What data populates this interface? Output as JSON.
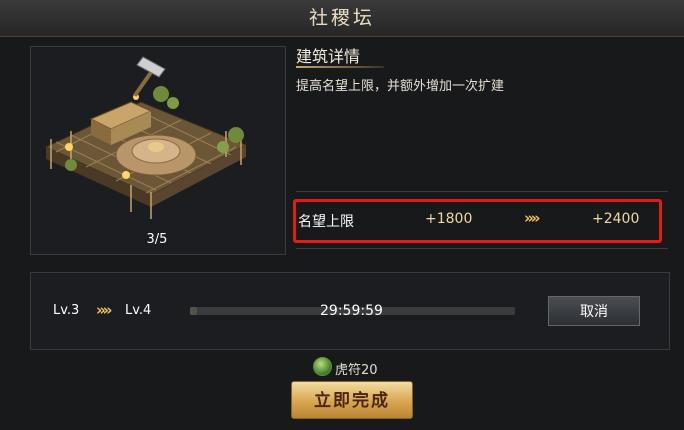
{
  "header": {
    "title": "社稷坛"
  },
  "building": {
    "icon": "hammer-icon",
    "progress_label": "3/5"
  },
  "details": {
    "section_title": "建筑详情",
    "description": "提高名望上限，并额外增加一次扩建",
    "stat": {
      "label": "名望上限",
      "current": "+1800",
      "arrow": "»»",
      "next": "+2400"
    }
  },
  "upgrade": {
    "from_level": "Lv.3",
    "arrow": "»»",
    "to_level": "Lv.4",
    "timer": "29:59:59",
    "progress_fraction": 0.02,
    "cancel_label": "取消"
  },
  "cost": {
    "icon": "tiger-tally-icon",
    "label": "虎符20"
  },
  "finish_label": "立即完成",
  "colors": {
    "highlight": "#e21b1b",
    "gold": "#d8a651",
    "chevron": "#f0c45a"
  }
}
